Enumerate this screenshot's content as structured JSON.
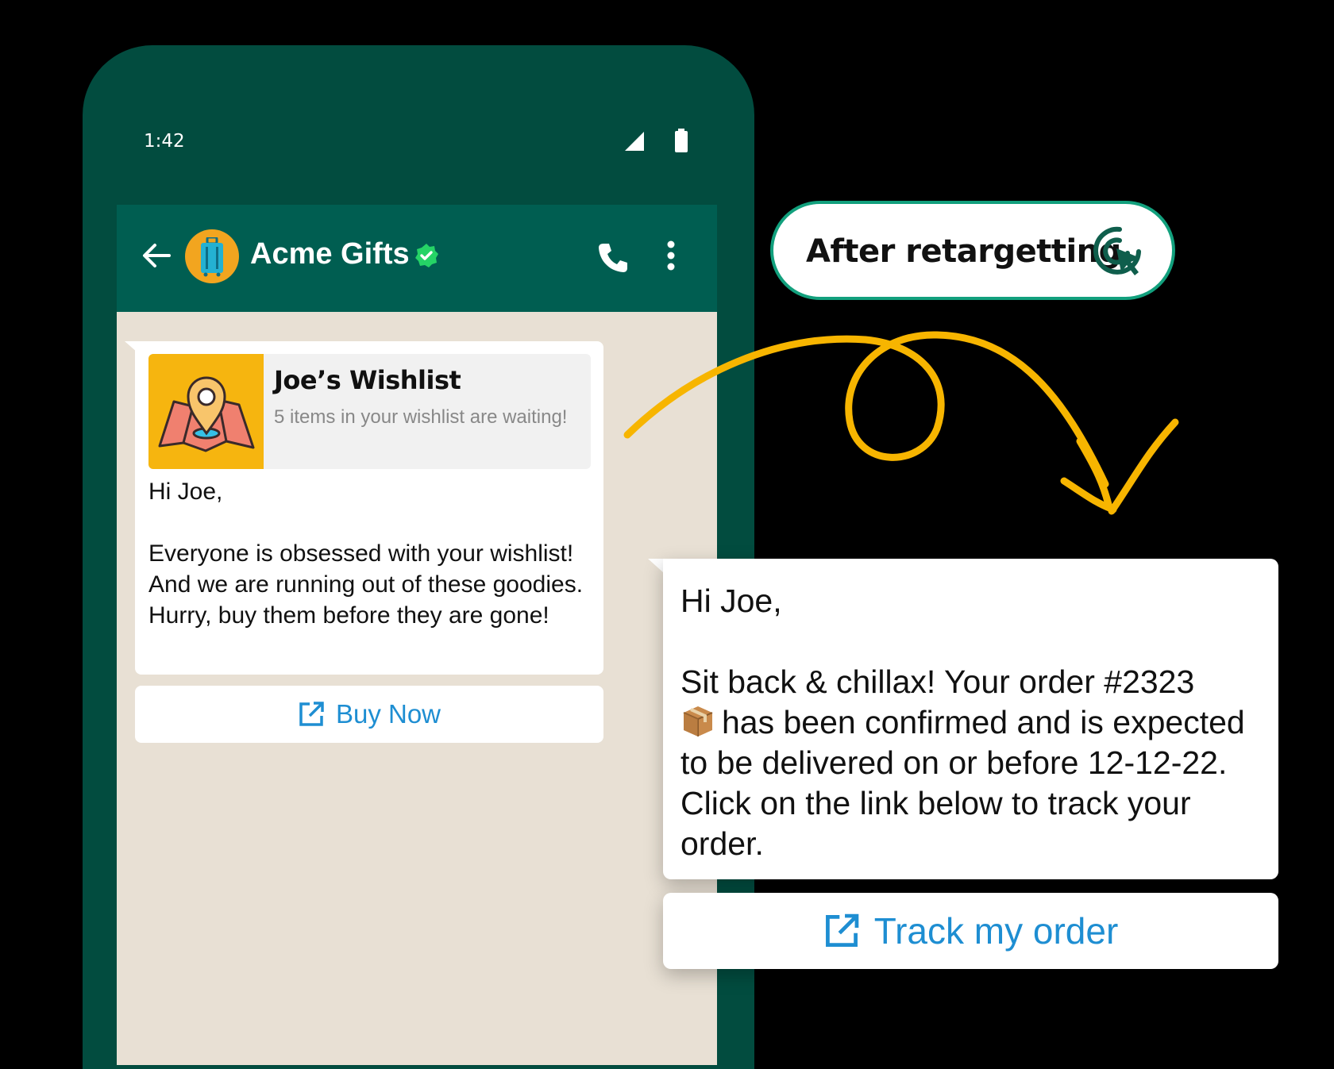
{
  "status_bar": {
    "time": "1:42"
  },
  "chat_header": {
    "name": "Acme Gifts"
  },
  "message1": {
    "preview_title": "Joe’s Wishlist",
    "preview_subtitle": "5 items in your wishlist are waiting!",
    "body": "Hi Joe,\n\nEveryone is obsessed with your wishlist! And we are running out of these goodies. Hurry, buy them before they are gone!",
    "button_label": "Buy Now"
  },
  "badge": {
    "label": "After retargetting"
  },
  "message2": {
    "greeting": "Hi Joe,",
    "body_part1": "Sit back & chillax! Your order #2323",
    "body_part2": "has been confirmed and is expected to be delivered on or before 12-12-22. Click on the link below to track your order.",
    "button_label": "Track my order"
  },
  "colors": {
    "phone_frame": "#024c3f",
    "app_bar": "#005e51",
    "chat_background": "#e8e0d4",
    "link_blue": "#1e8ed2",
    "accent_green": "#12a07d",
    "scribble_yellow": "#f7b500"
  },
  "icons": [
    "signal-icon",
    "battery-icon",
    "back-arrow-icon",
    "luggage-icon",
    "verified-icon",
    "call-icon",
    "more-options-icon",
    "map-pin-icon",
    "external-link-icon",
    "cursor-click-icon",
    "package-icon"
  ]
}
